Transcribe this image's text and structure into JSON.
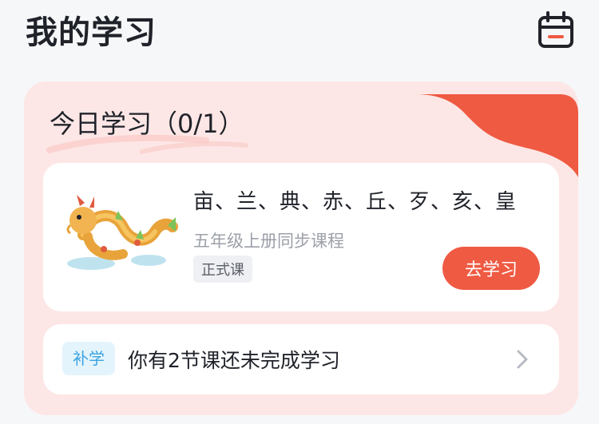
{
  "header": {
    "title": "我的学习",
    "calendar_icon": "calendar-icon"
  },
  "today": {
    "title": "今日学习（0/1）",
    "lesson": {
      "title": "亩、兰、典、赤、丘、歹、亥、皇",
      "subtitle": "五年级上册同步课程",
      "tag": "正式课",
      "button_label": "去学习",
      "image": "dragon-illustration"
    },
    "makeup": {
      "badge": "补学",
      "text": "你有2节课还未完成学习",
      "arrow_icon": "chevron-right-icon"
    }
  },
  "colors": {
    "accent": "#ef5a42",
    "card_background": "#fde7e6",
    "badge_blue": "#3aa4e0",
    "badge_blue_bg": "#e4f4fc"
  }
}
